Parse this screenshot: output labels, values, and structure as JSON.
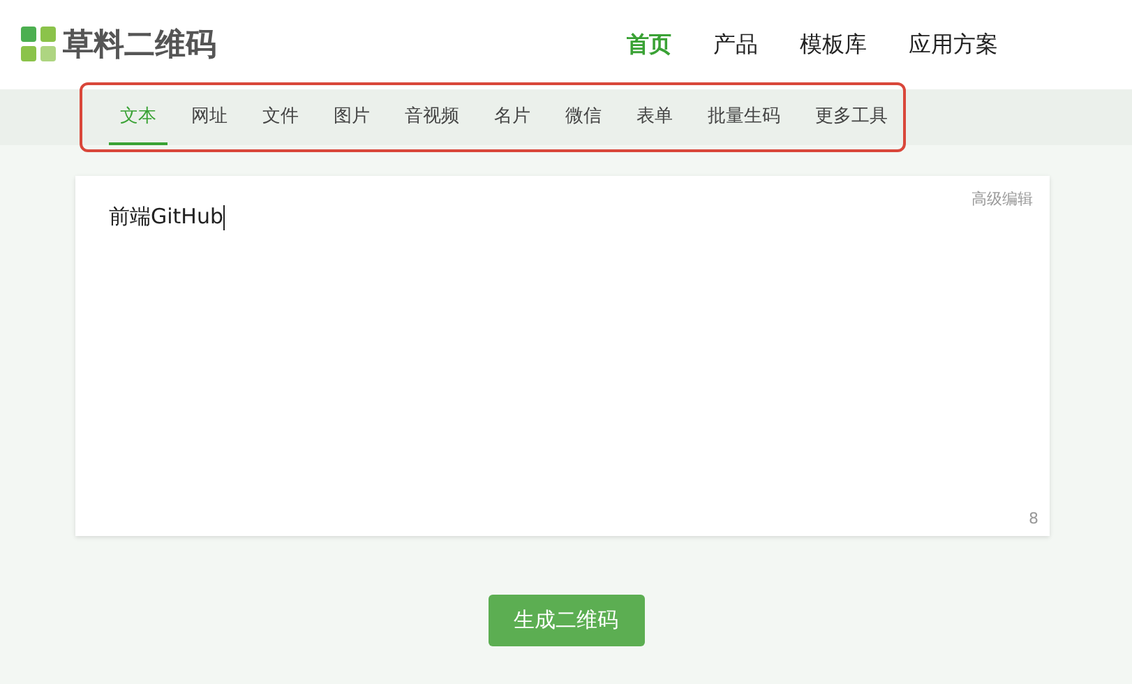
{
  "logo": {
    "text": "草料二维码"
  },
  "nav": [
    {
      "label": "首页",
      "selected": true
    },
    {
      "label": "产品",
      "selected": false
    },
    {
      "label": "模板库",
      "selected": false
    },
    {
      "label": "应用方案",
      "selected": false
    }
  ],
  "tabs": [
    {
      "label": "文本",
      "selected": true
    },
    {
      "label": "网址",
      "selected": false
    },
    {
      "label": "文件",
      "selected": false
    },
    {
      "label": "图片",
      "selected": false
    },
    {
      "label": "音视频",
      "selected": false
    },
    {
      "label": "名片",
      "selected": false
    },
    {
      "label": "微信",
      "selected": false
    },
    {
      "label": "表单",
      "selected": false
    },
    {
      "label": "批量生码",
      "selected": false
    },
    {
      "label": "更多工具",
      "selected": false
    }
  ],
  "editor": {
    "value": "前端GitHub",
    "advanced_link": "高级编辑",
    "count": "8"
  },
  "generate_button": "生成二维码"
}
